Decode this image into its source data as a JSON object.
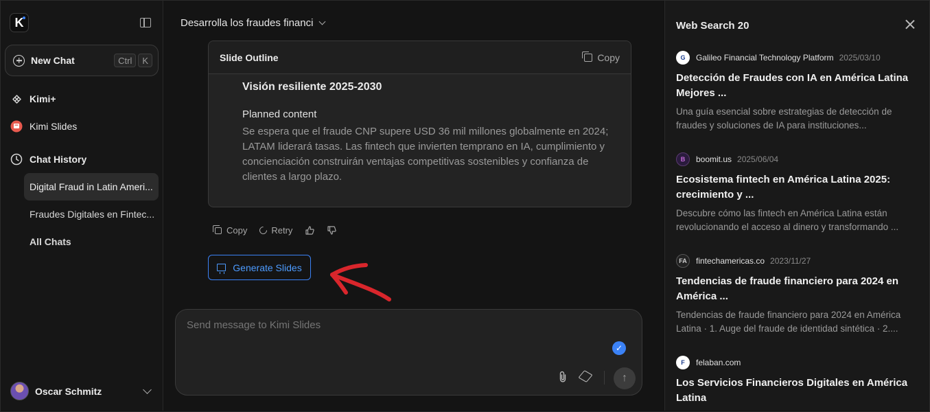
{
  "sidebar": {
    "logo_letter": "K",
    "new_chat": {
      "label": "New Chat",
      "shortcut_ctrl": "Ctrl",
      "shortcut_key": "K"
    },
    "kimi_plus": "Kimi+",
    "kimi_slides": "Kimi Slides",
    "chat_history": "Chat History",
    "history": [
      {
        "label": "Digital Fraud in Latin Ameri..."
      },
      {
        "label": "Fraudes Digitales en Fintec..."
      }
    ],
    "all_chats": "All Chats",
    "user": {
      "name": "Oscar Schmitz"
    }
  },
  "main": {
    "chat_title": "Desarrolla los fraudes financi",
    "outline": {
      "header": "Slide Outline",
      "copy_label": "Copy",
      "section_title": "Visión resiliente 2025-2030",
      "planned_label": "Planned content",
      "planned_text": "Se espera que el fraude CNP supere USD 36 mil millones globalmente en 2024; LATAM liderará tasas. Las fintech que invierten temprano en IA, cumplimiento y concienciación construirán ventajas competitivas sostenibles y confianza de clientes a largo plazo."
    },
    "actions": {
      "copy": "Copy",
      "retry": "Retry"
    },
    "generate_slides": "Generate Slides",
    "composer": {
      "placeholder": "Send message to Kimi Slides"
    }
  },
  "panel": {
    "title": "Web Search 20",
    "results": [
      {
        "source": "Galileo Financial Technology Platform",
        "date": "2025/03/10",
        "title": "Detección de Fraudes con IA en América Latina Mejores ...",
        "snippet": "Una guía esencial sobre estrategias de detección de fraudes y soluciones de IA para instituciones..."
      },
      {
        "source": "boomit.us",
        "date": "2025/06/04",
        "title": "Ecosistema fintech en América Latina 2025: crecimiento y ...",
        "snippet": "Descubre cómo las fintech en América Latina están revolucionando el acceso al dinero y transformando ..."
      },
      {
        "source": "fintechamericas.co",
        "date": "2023/11/27",
        "title": "Tendencias de fraude financiero para 2024 en América ...",
        "snippet": "Tendencias de fraude financiero para 2024 en América Latina · 1. Auge del fraude de identidad sintética · 2...."
      },
      {
        "source": "felaban.com",
        "date": "",
        "title": "Los Servicios Financieros Digitales en América Latina",
        "snippet": ""
      }
    ]
  },
  "colors": {
    "accent": "#3b82f6",
    "arrow": "#d9262c",
    "background": "#141414"
  }
}
